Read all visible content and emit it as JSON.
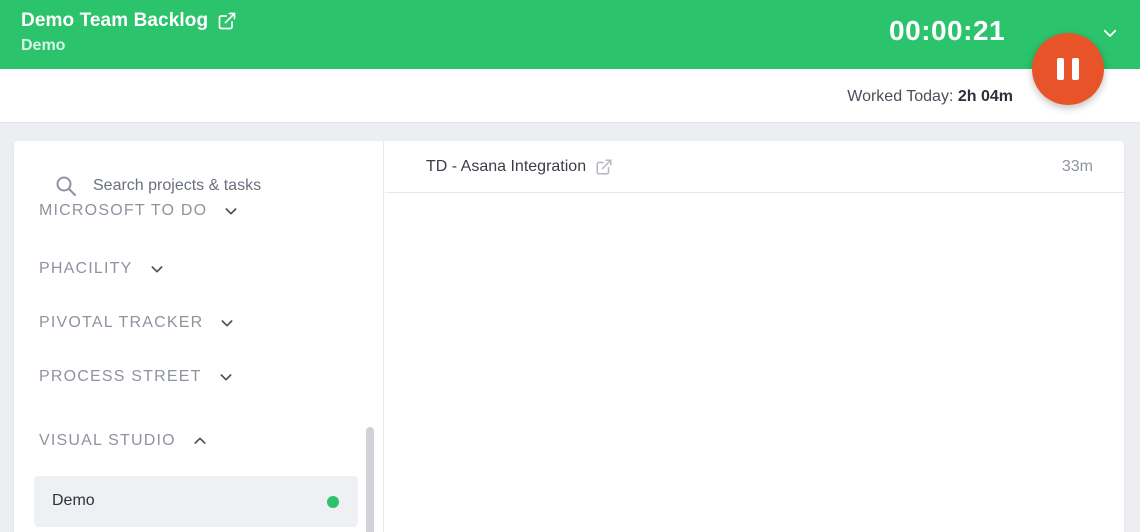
{
  "header": {
    "title": "Demo Team Backlog",
    "subtitle": "Demo",
    "timer": "00:00:21",
    "worked_today_label": "Worked Today:",
    "worked_today_value": "2h 04m"
  },
  "sidebar": {
    "search_placeholder": "Search projects & tasks",
    "groups": [
      {
        "label": "MICROSOFT TO DO",
        "expanded": false
      },
      {
        "label": "PHACILITY",
        "expanded": false
      },
      {
        "label": "PIVOTAL TRACKER",
        "expanded": false
      },
      {
        "label": "PROCESS STREET",
        "expanded": false
      },
      {
        "label": "VISUAL STUDIO",
        "expanded": true
      }
    ],
    "selected_item": {
      "label": "Demo",
      "status_color": "#2bc36b"
    }
  },
  "tasks": [
    {
      "name": "TD - Asana Integration",
      "time": "33m"
    }
  ],
  "colors": {
    "brand_green": "#2bc36b",
    "pause_button": "#e9532a"
  },
  "icons": {
    "title_link": "external-link-icon",
    "header_menu": "chevron-down-icon",
    "pause": "pause-icon",
    "search": "search-icon",
    "task_link": "external-link-icon"
  }
}
